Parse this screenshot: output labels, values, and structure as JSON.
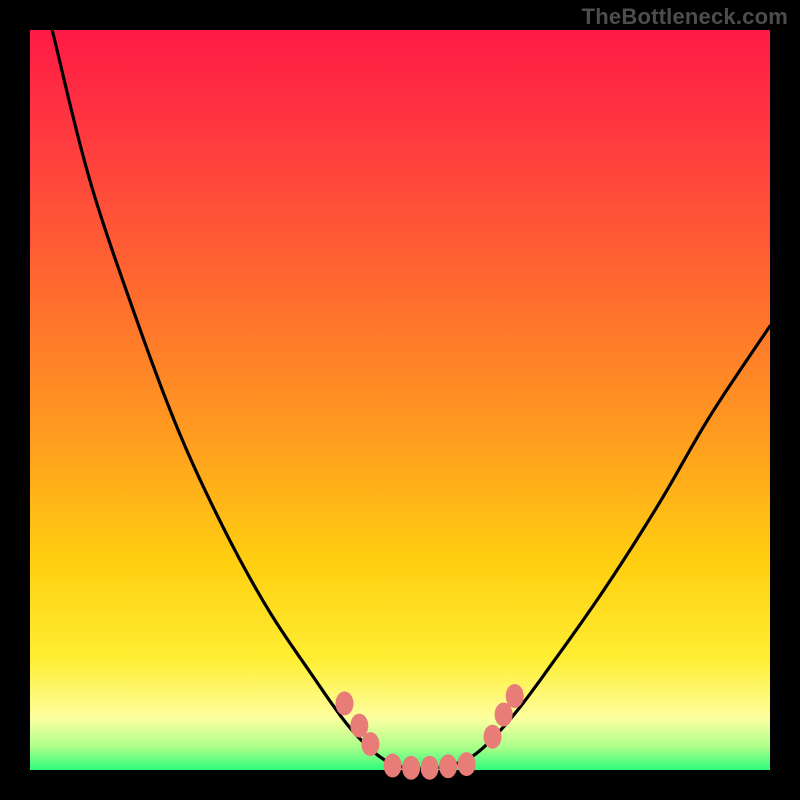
{
  "watermark": "TheBottleneck.com",
  "colors": {
    "gradient": [
      "#ff1a45",
      "#ff3b3f",
      "#ff6a2f",
      "#ff9c1f",
      "#ffcf10",
      "#ffee33",
      "#fdffa0",
      "#a8ff8a",
      "#2dfb7a"
    ],
    "curve_stroke": "#000000",
    "marker_fill": "#e87c77",
    "marker_stroke": "#b94f4c"
  },
  "chart_data": {
    "type": "line",
    "title": "",
    "xlabel": "",
    "ylabel": "",
    "xlim": [
      0,
      100
    ],
    "ylim": [
      0,
      100
    ],
    "grid": false,
    "legend": false,
    "notes": "V-shaped bottleneck curve overlaid on a red→green vertical gradient. Lower y = better (green). Curve approaches its minimum near x≈48–60 where bottleneck ≈ 0. Left branch starts near (3,100), right branch reaches ≈(100,60). Pink markers highlight near-minimum points on both flanks and along the flat minimum.",
    "series": [
      {
        "name": "bottleneck_curve",
        "x": [
          3,
          8,
          14,
          20,
          26,
          32,
          38,
          43,
          47,
          50,
          53,
          56,
          60,
          65,
          71,
          78,
          85,
          92,
          100
        ],
        "y": [
          100,
          80,
          62,
          46,
          33,
          22,
          13,
          6,
          2,
          0.5,
          0.2,
          0.5,
          2,
          7,
          15,
          25,
          36,
          48,
          60
        ]
      }
    ],
    "markers": [
      {
        "x": 42.5,
        "y": 9
      },
      {
        "x": 44.5,
        "y": 6
      },
      {
        "x": 46.0,
        "y": 3.5
      },
      {
        "x": 49.0,
        "y": 0.6
      },
      {
        "x": 51.5,
        "y": 0.3
      },
      {
        "x": 54.0,
        "y": 0.3
      },
      {
        "x": 56.5,
        "y": 0.5
      },
      {
        "x": 59.0,
        "y": 0.8
      },
      {
        "x": 62.5,
        "y": 4.5
      },
      {
        "x": 64.0,
        "y": 7.5
      },
      {
        "x": 65.5,
        "y": 10
      }
    ]
  }
}
